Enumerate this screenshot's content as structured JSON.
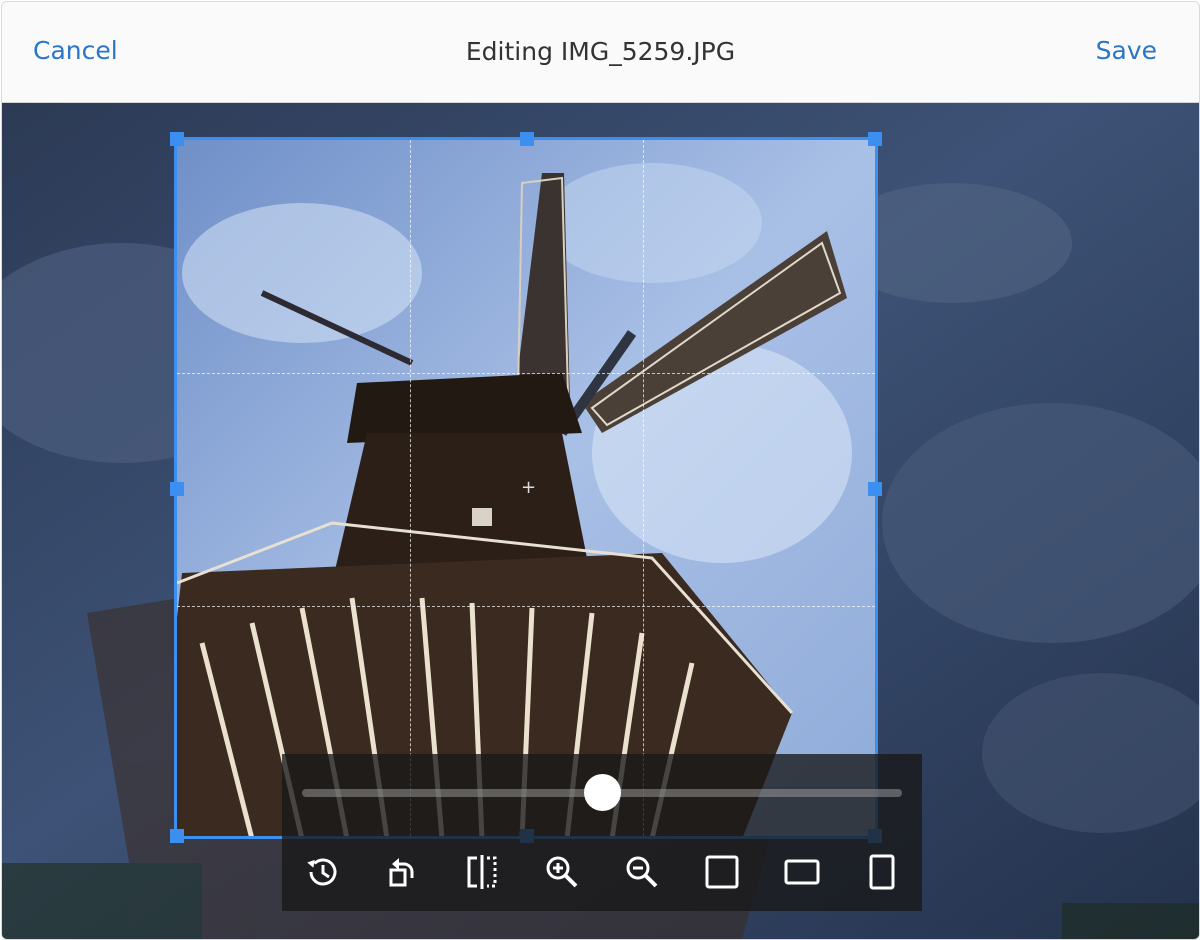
{
  "header": {
    "cancel_label": "Cancel",
    "title": "Editing IMG_5259.JPG",
    "save_label": "Save"
  },
  "colors": {
    "accent": "#2a76c6",
    "crop_frame": "#3a8ff0",
    "panel_background": "#181818"
  },
  "zoom_slider": {
    "value_fraction": 0.5
  },
  "toolbar": {
    "tools": [
      {
        "name": "reset",
        "icon": "history-icon"
      },
      {
        "name": "rotate",
        "icon": "rotate-left-icon"
      },
      {
        "name": "flip",
        "icon": "flip-horizontal-icon"
      },
      {
        "name": "zoom-in",
        "icon": "zoom-in-icon"
      },
      {
        "name": "zoom-out",
        "icon": "zoom-out-icon"
      },
      {
        "name": "aspect-square",
        "icon": "aspect-square-icon"
      },
      {
        "name": "aspect-landscape",
        "icon": "aspect-landscape-icon"
      },
      {
        "name": "aspect-portrait",
        "icon": "aspect-portrait-icon"
      }
    ]
  }
}
